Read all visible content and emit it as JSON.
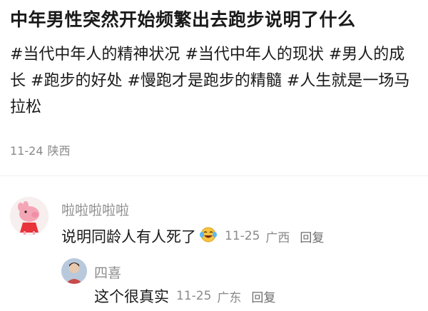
{
  "post": {
    "title": "中年男性突然开始频繁出去跑步说明了什么",
    "tags": [
      "#当代中年人的精神状况",
      "#当代中年人的现状",
      "#男人的成长",
      "#跑步的好处",
      "#慢跑才是跑步的精髓",
      "#人生就是一场马拉松"
    ],
    "date": "11-24",
    "location": "陕西"
  },
  "comments": [
    {
      "username": "啦啦啦啦啦",
      "text": "说明同龄人有人死了",
      "emoji": "crying-laughing-icon",
      "date": "11-25",
      "location": "广西",
      "reply_label": "回复",
      "replies": [
        {
          "username": "四喜",
          "text": "这个很真实",
          "date": "11-25",
          "location": "广东",
          "reply_label": "回复"
        }
      ]
    }
  ]
}
